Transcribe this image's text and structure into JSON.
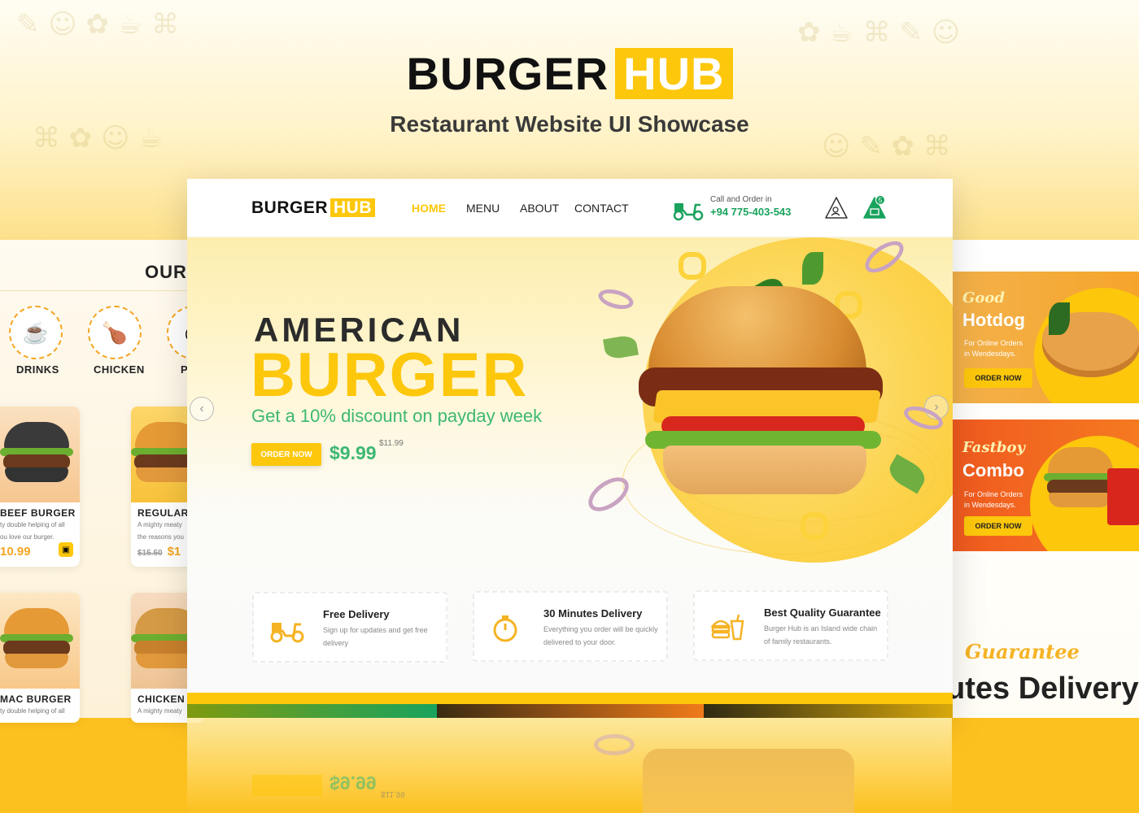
{
  "showcase": {
    "brand_main": "BURGER",
    "brand_accent": "HUB",
    "tagline": "Restaurant Website UI Showcase"
  },
  "colors": {
    "brand_yellow": "#fdc70c",
    "brand_green": "#19a35d",
    "text_dark": "#222222"
  },
  "nav": {
    "logo_main": "BURGER",
    "logo_accent": "HUB",
    "links": [
      "HOME",
      "MENU",
      "ABOUT",
      "CONTACT"
    ],
    "active_link": "HOME",
    "call_label": "Call and Order in",
    "phone": "+94 775-403-543",
    "icons": [
      "scooter-icon",
      "user-icon",
      "basket-icon"
    ],
    "cart_count": "5"
  },
  "hero": {
    "eyebrow": "AMERICAN",
    "title": "BURGER",
    "discount": "Get a 10% discount on payday week",
    "order_button": "ORDER NOW",
    "price": "$9.99",
    "old_price": "$11.99"
  },
  "features": [
    {
      "title": "Free Delivery",
      "desc": "Sign up for updates and get free delivery",
      "icon": "scooter-icon"
    },
    {
      "title": "30 Minutes Delivery",
      "desc": "Everything you order will be quickly delivered to your door.",
      "icon": "stopwatch-icon"
    },
    {
      "title": "Best Quality Guarantee",
      "desc": "Burger Hub is an Island wide chain of family restaurants.",
      "icon": "fastfood-icon"
    }
  ],
  "left_panel": {
    "heading": "OUR",
    "categories": [
      "DRINKS",
      "CHICKEN",
      "P"
    ],
    "products": [
      {
        "name": "BEEF BURGER",
        "desc_line1": "ty double helping of all",
        "desc_line2": "ou love our burger.",
        "price": "10.99",
        "old_price": ""
      },
      {
        "name": "REGULAR",
        "desc_line1": "A mighty meaty",
        "desc_line2": "the reasons you",
        "price": "$1",
        "old_price": "$15.50"
      },
      {
        "name": "MAC BURGER",
        "desc_line1": "ty double helping of all",
        "desc_line2": "",
        "price": "",
        "old_price": ""
      },
      {
        "name": "CHICKEN BU",
        "desc_line1": "A mighty meaty",
        "desc_line2": "",
        "price": "",
        "old_price": ""
      }
    ]
  },
  "right_panel": {
    "promos": [
      {
        "script": "Good",
        "title": "Hotdog",
        "sub_line1": "For Online Orders",
        "sub_line2": "in Wendesdays.",
        "button": "ORDER NOW"
      },
      {
        "script": "Fastboy",
        "title": "Combo",
        "sub_line1": "For Online Orders",
        "sub_line2": "in Wendesdays.",
        "button": "ORDER NOW"
      }
    ],
    "guarantee_script": "Guarantee",
    "big_text": "utes Delivery!"
  },
  "reflection": {
    "price": "$9.99",
    "old_price": "$11.99"
  }
}
